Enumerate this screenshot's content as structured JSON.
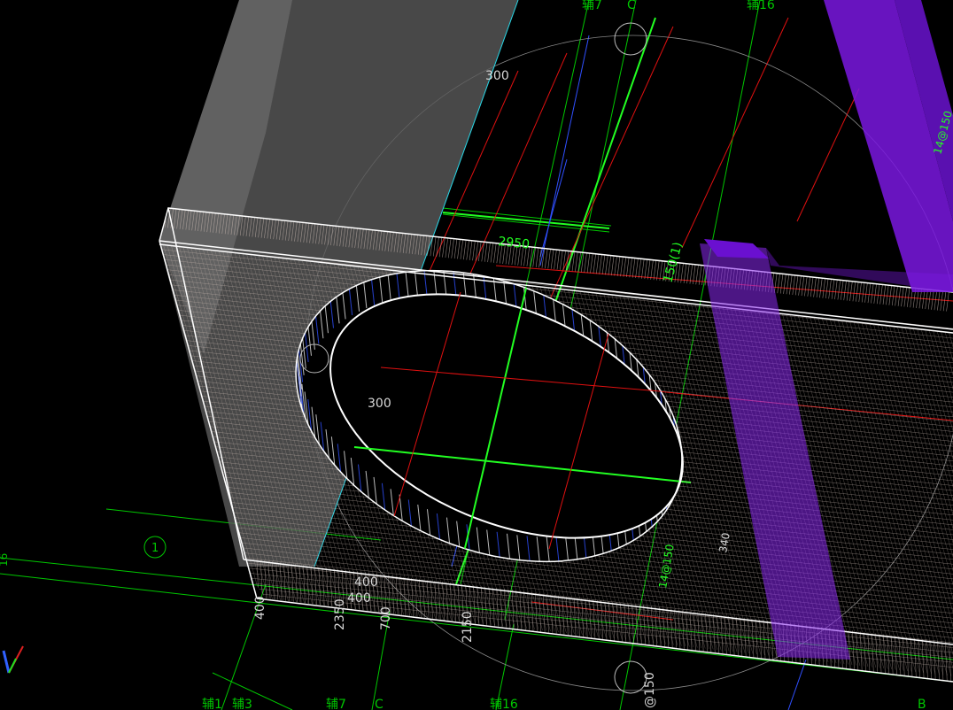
{
  "viewport": {
    "background": "#000000",
    "colors": {
      "grid_green": "#00c800",
      "grid_bright": "#22ff22",
      "rebar_red": "#e01010",
      "rebar_blue": "#3050ff",
      "mesh": "#c8b8b0",
      "edge_white": "#ffffff",
      "column_gray": "#5a5a5a",
      "member_purple": "#7a18e0",
      "cyan_line": "#28d8e8",
      "yellow_line": "#d8d000"
    },
    "icons": {
      "axis_gizmo": "xyz-axis-gizmo-icon"
    }
  },
  "labels": {
    "axis_top_1": "辅7",
    "axis_top_2": "C",
    "axis_top_3": "辅16",
    "axis_bottom_1": "辅1",
    "axis_bottom_2": "辅3",
    "axis_bottom_3": "辅7",
    "axis_bottom_4": "C",
    "axis_bottom_5": "辅16",
    "axis_bottom_6": "B",
    "grid_bubble_1": "1",
    "dim_300_top": "300",
    "dim_300_mid": "300",
    "dim_2950": "2950",
    "dim_150_top": "150(1)",
    "dim_150_side": "14@150",
    "dim_400_a": "400",
    "dim_400_b": "400",
    "dim_400_c": "400",
    "dim_2350": "2350",
    "dim_700": "700",
    "dim_2150": "2150",
    "dim_150_bottom": "@150",
    "dim_340": "340",
    "dim_rebar": "14@150",
    "left_edge_text": "16"
  }
}
